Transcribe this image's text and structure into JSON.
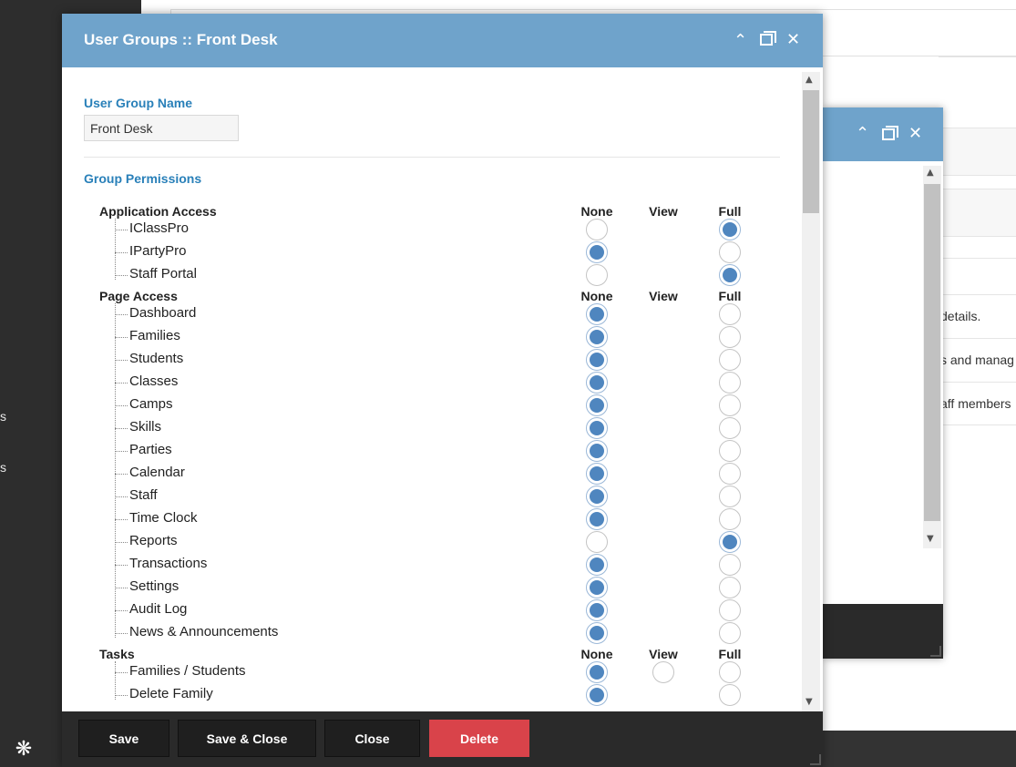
{
  "dialog": {
    "title": "User Groups :: Front Desk",
    "name_label": "User Group Name",
    "name_value": "Front Desk",
    "permissions_label": "Group Permissions",
    "columns": {
      "none": "None",
      "view": "View",
      "full": "Full"
    },
    "groups": [
      {
        "title": "Application Access",
        "items": [
          {
            "label": "IClassPro",
            "value": "full"
          },
          {
            "label": "IPartyPro",
            "value": "none"
          },
          {
            "label": "Staff Portal",
            "value": "full"
          }
        ]
      },
      {
        "title": "Page Access",
        "items": [
          {
            "label": "Dashboard",
            "value": "none"
          },
          {
            "label": "Families",
            "value": "none"
          },
          {
            "label": "Students",
            "value": "none"
          },
          {
            "label": "Classes",
            "value": "none"
          },
          {
            "label": "Camps",
            "value": "none"
          },
          {
            "label": "Skills",
            "value": "none"
          },
          {
            "label": "Parties",
            "value": "none"
          },
          {
            "label": "Calendar",
            "value": "none"
          },
          {
            "label": "Staff",
            "value": "none"
          },
          {
            "label": "Time Clock",
            "value": "none"
          },
          {
            "label": "Reports",
            "value": "full"
          },
          {
            "label": "Transactions",
            "value": "none"
          },
          {
            "label": "Settings",
            "value": "none"
          },
          {
            "label": "Audit Log",
            "value": "none"
          },
          {
            "label": "News & Announcements",
            "value": "none"
          }
        ]
      },
      {
        "title": "Tasks",
        "items": [
          {
            "label": "Families / Students",
            "value": "none",
            "has_view": true
          },
          {
            "label": "Delete Family",
            "value": "none"
          }
        ]
      }
    ],
    "footer": {
      "save": "Save",
      "save_close": "Save & Close",
      "close": "Close",
      "delete": "Delete"
    },
    "colors": {
      "header": "#6fa3cb",
      "accent": "#2980b9",
      "radio_on": "#4f86bf",
      "delete": "#d9434a"
    }
  },
  "background": {
    "texts": [
      "details.",
      "s and manag",
      "aff members"
    ],
    "sidebar_fragments": [
      "s",
      "s"
    ]
  },
  "icons": {
    "minimize": "chevron-up-icon",
    "maximize": "window-restore-icon",
    "close": "close-icon",
    "spinner": "loading-spinner-icon"
  }
}
